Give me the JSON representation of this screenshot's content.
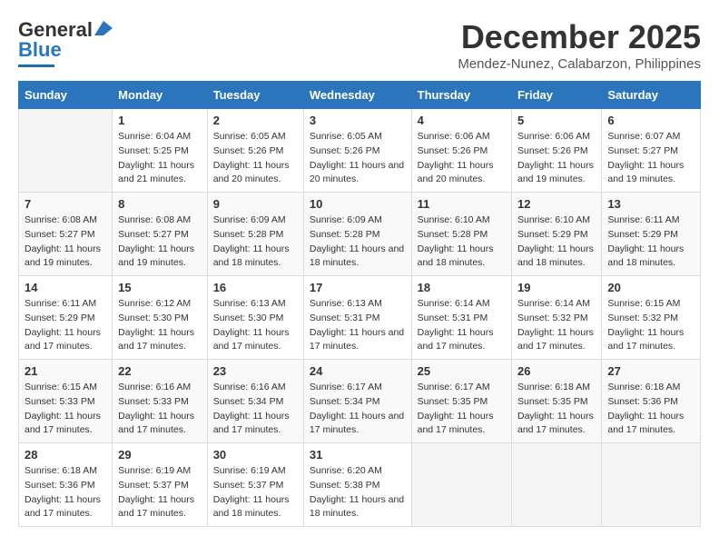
{
  "header": {
    "logo_line1": "General",
    "logo_line2": "Blue",
    "month": "December 2025",
    "location": "Mendez-Nunez, Calabarzon, Philippines"
  },
  "columns": [
    "Sunday",
    "Monday",
    "Tuesday",
    "Wednesday",
    "Thursday",
    "Friday",
    "Saturday"
  ],
  "weeks": [
    [
      {
        "day": "",
        "sunrise": "",
        "sunset": "",
        "daylight": ""
      },
      {
        "day": "1",
        "sunrise": "Sunrise: 6:04 AM",
        "sunset": "Sunset: 5:25 PM",
        "daylight": "Daylight: 11 hours and 21 minutes."
      },
      {
        "day": "2",
        "sunrise": "Sunrise: 6:05 AM",
        "sunset": "Sunset: 5:26 PM",
        "daylight": "Daylight: 11 hours and 20 minutes."
      },
      {
        "day": "3",
        "sunrise": "Sunrise: 6:05 AM",
        "sunset": "Sunset: 5:26 PM",
        "daylight": "Daylight: 11 hours and 20 minutes."
      },
      {
        "day": "4",
        "sunrise": "Sunrise: 6:06 AM",
        "sunset": "Sunset: 5:26 PM",
        "daylight": "Daylight: 11 hours and 20 minutes."
      },
      {
        "day": "5",
        "sunrise": "Sunrise: 6:06 AM",
        "sunset": "Sunset: 5:26 PM",
        "daylight": "Daylight: 11 hours and 19 minutes."
      },
      {
        "day": "6",
        "sunrise": "Sunrise: 6:07 AM",
        "sunset": "Sunset: 5:27 PM",
        "daylight": "Daylight: 11 hours and 19 minutes."
      }
    ],
    [
      {
        "day": "7",
        "sunrise": "Sunrise: 6:08 AM",
        "sunset": "Sunset: 5:27 PM",
        "daylight": "Daylight: 11 hours and 19 minutes."
      },
      {
        "day": "8",
        "sunrise": "Sunrise: 6:08 AM",
        "sunset": "Sunset: 5:27 PM",
        "daylight": "Daylight: 11 hours and 19 minutes."
      },
      {
        "day": "9",
        "sunrise": "Sunrise: 6:09 AM",
        "sunset": "Sunset: 5:28 PM",
        "daylight": "Daylight: 11 hours and 18 minutes."
      },
      {
        "day": "10",
        "sunrise": "Sunrise: 6:09 AM",
        "sunset": "Sunset: 5:28 PM",
        "daylight": "Daylight: 11 hours and 18 minutes."
      },
      {
        "day": "11",
        "sunrise": "Sunrise: 6:10 AM",
        "sunset": "Sunset: 5:28 PM",
        "daylight": "Daylight: 11 hours and 18 minutes."
      },
      {
        "day": "12",
        "sunrise": "Sunrise: 6:10 AM",
        "sunset": "Sunset: 5:29 PM",
        "daylight": "Daylight: 11 hours and 18 minutes."
      },
      {
        "day": "13",
        "sunrise": "Sunrise: 6:11 AM",
        "sunset": "Sunset: 5:29 PM",
        "daylight": "Daylight: 11 hours and 18 minutes."
      }
    ],
    [
      {
        "day": "14",
        "sunrise": "Sunrise: 6:11 AM",
        "sunset": "Sunset: 5:29 PM",
        "daylight": "Daylight: 11 hours and 17 minutes."
      },
      {
        "day": "15",
        "sunrise": "Sunrise: 6:12 AM",
        "sunset": "Sunset: 5:30 PM",
        "daylight": "Daylight: 11 hours and 17 minutes."
      },
      {
        "day": "16",
        "sunrise": "Sunrise: 6:13 AM",
        "sunset": "Sunset: 5:30 PM",
        "daylight": "Daylight: 11 hours and 17 minutes."
      },
      {
        "day": "17",
        "sunrise": "Sunrise: 6:13 AM",
        "sunset": "Sunset: 5:31 PM",
        "daylight": "Daylight: 11 hours and 17 minutes."
      },
      {
        "day": "18",
        "sunrise": "Sunrise: 6:14 AM",
        "sunset": "Sunset: 5:31 PM",
        "daylight": "Daylight: 11 hours and 17 minutes."
      },
      {
        "day": "19",
        "sunrise": "Sunrise: 6:14 AM",
        "sunset": "Sunset: 5:32 PM",
        "daylight": "Daylight: 11 hours and 17 minutes."
      },
      {
        "day": "20",
        "sunrise": "Sunrise: 6:15 AM",
        "sunset": "Sunset: 5:32 PM",
        "daylight": "Daylight: 11 hours and 17 minutes."
      }
    ],
    [
      {
        "day": "21",
        "sunrise": "Sunrise: 6:15 AM",
        "sunset": "Sunset: 5:33 PM",
        "daylight": "Daylight: 11 hours and 17 minutes."
      },
      {
        "day": "22",
        "sunrise": "Sunrise: 6:16 AM",
        "sunset": "Sunset: 5:33 PM",
        "daylight": "Daylight: 11 hours and 17 minutes."
      },
      {
        "day": "23",
        "sunrise": "Sunrise: 6:16 AM",
        "sunset": "Sunset: 5:34 PM",
        "daylight": "Daylight: 11 hours and 17 minutes."
      },
      {
        "day": "24",
        "sunrise": "Sunrise: 6:17 AM",
        "sunset": "Sunset: 5:34 PM",
        "daylight": "Daylight: 11 hours and 17 minutes."
      },
      {
        "day": "25",
        "sunrise": "Sunrise: 6:17 AM",
        "sunset": "Sunset: 5:35 PM",
        "daylight": "Daylight: 11 hours and 17 minutes."
      },
      {
        "day": "26",
        "sunrise": "Sunrise: 6:18 AM",
        "sunset": "Sunset: 5:35 PM",
        "daylight": "Daylight: 11 hours and 17 minutes."
      },
      {
        "day": "27",
        "sunrise": "Sunrise: 6:18 AM",
        "sunset": "Sunset: 5:36 PM",
        "daylight": "Daylight: 11 hours and 17 minutes."
      }
    ],
    [
      {
        "day": "28",
        "sunrise": "Sunrise: 6:18 AM",
        "sunset": "Sunset: 5:36 PM",
        "daylight": "Daylight: 11 hours and 17 minutes."
      },
      {
        "day": "29",
        "sunrise": "Sunrise: 6:19 AM",
        "sunset": "Sunset: 5:37 PM",
        "daylight": "Daylight: 11 hours and 17 minutes."
      },
      {
        "day": "30",
        "sunrise": "Sunrise: 6:19 AM",
        "sunset": "Sunset: 5:37 PM",
        "daylight": "Daylight: 11 hours and 18 minutes."
      },
      {
        "day": "31",
        "sunrise": "Sunrise: 6:20 AM",
        "sunset": "Sunset: 5:38 PM",
        "daylight": "Daylight: 11 hours and 18 minutes."
      },
      {
        "day": "",
        "sunrise": "",
        "sunset": "",
        "daylight": ""
      },
      {
        "day": "",
        "sunrise": "",
        "sunset": "",
        "daylight": ""
      },
      {
        "day": "",
        "sunrise": "",
        "sunset": "",
        "daylight": ""
      }
    ]
  ]
}
